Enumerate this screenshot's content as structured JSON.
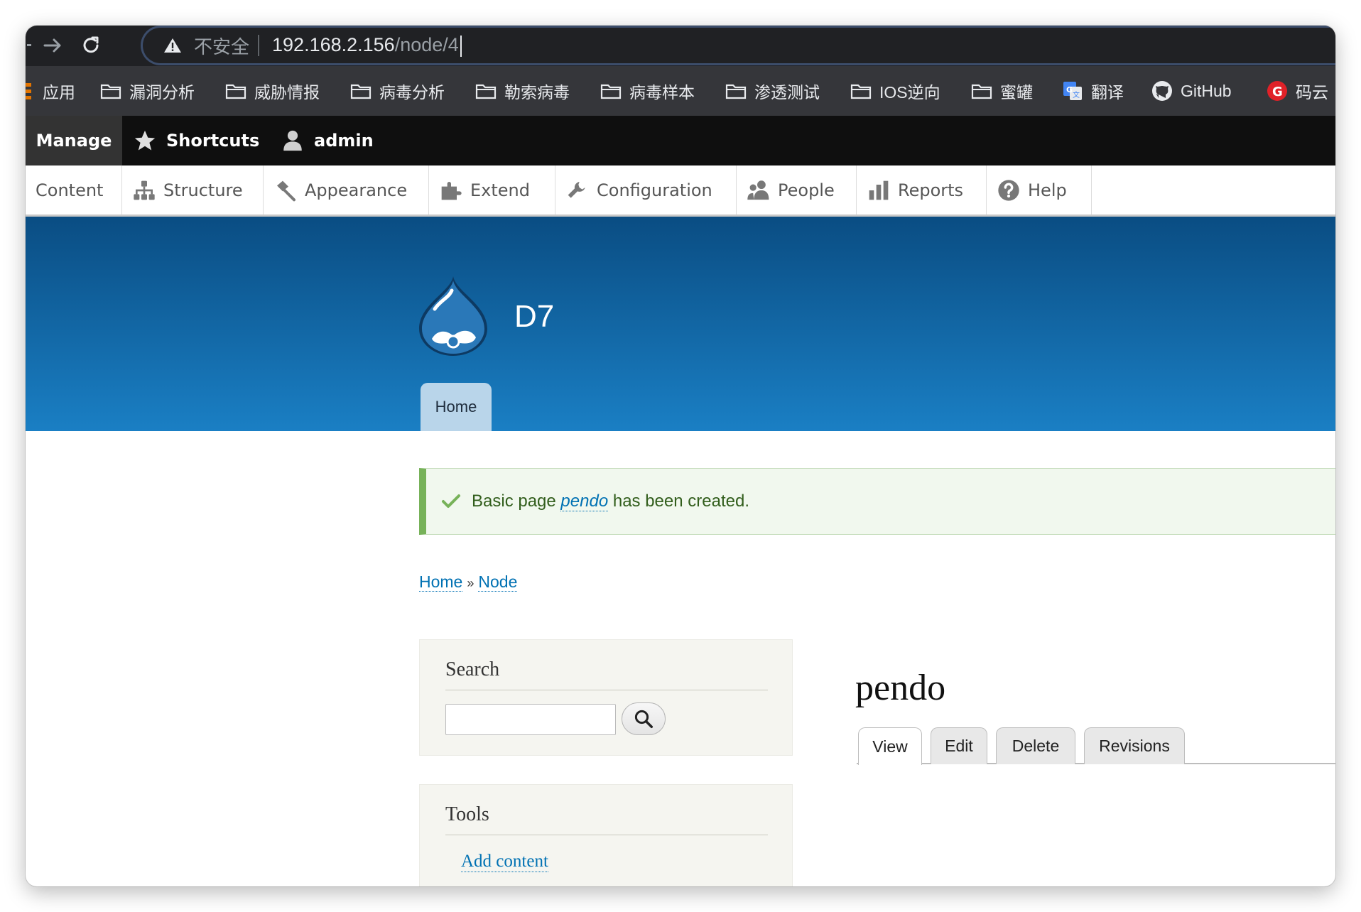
{
  "browser": {
    "omnibox": {
      "security_label": "不安全",
      "url_host": "192.168.2.156",
      "url_path": "/node/4"
    },
    "bookmarks": [
      {
        "label": "应用",
        "icon": "apps-icon"
      },
      {
        "label": "漏洞分析",
        "icon": "folder-icon"
      },
      {
        "label": "威胁情报",
        "icon": "folder-icon"
      },
      {
        "label": "病毒分析",
        "icon": "folder-icon"
      },
      {
        "label": "勒索病毒",
        "icon": "folder-icon"
      },
      {
        "label": "病毒样本",
        "icon": "folder-icon"
      },
      {
        "label": "渗透测试",
        "icon": "folder-icon"
      },
      {
        "label": "IOS逆向",
        "icon": "folder-icon"
      },
      {
        "label": "蜜罐",
        "icon": "folder-icon"
      },
      {
        "label": "翻译",
        "icon": "google-translate-icon"
      },
      {
        "label": "GitHub",
        "icon": "github-icon"
      },
      {
        "label": "码云",
        "icon": "gitee-icon"
      }
    ]
  },
  "toolbar": {
    "manage": "Manage",
    "shortcuts": "Shortcuts",
    "user": "admin",
    "tray": [
      {
        "label": "Content",
        "icon": ""
      },
      {
        "label": "Structure",
        "icon": "structure-icon"
      },
      {
        "label": "Appearance",
        "icon": "appearance-icon"
      },
      {
        "label": "Extend",
        "icon": "extend-icon"
      },
      {
        "label": "Configuration",
        "icon": "wrench-icon"
      },
      {
        "label": "People",
        "icon": "people-icon"
      },
      {
        "label": "Reports",
        "icon": "reports-icon"
      },
      {
        "label": "Help",
        "icon": "help-icon"
      }
    ]
  },
  "header": {
    "site_name": "D7",
    "home_tab": "Home"
  },
  "message": {
    "prefix": "Basic page ",
    "link": "pendo",
    "suffix": " has been created."
  },
  "breadcrumb": {
    "items": [
      "Home",
      "Node"
    ],
    "separator": "»"
  },
  "sidebar": {
    "search": {
      "title": "Search",
      "value": ""
    },
    "tools": {
      "title": "Tools",
      "link": "Add content"
    }
  },
  "content": {
    "title": "pendo",
    "tabs": [
      "View",
      "Edit",
      "Delete",
      "Revisions"
    ],
    "active_tab": "View"
  },
  "colors": {
    "header_top": "#0a4d83",
    "header_bottom": "#1a7fc4",
    "link": "#0071b3",
    "status_border": "#77b259"
  }
}
